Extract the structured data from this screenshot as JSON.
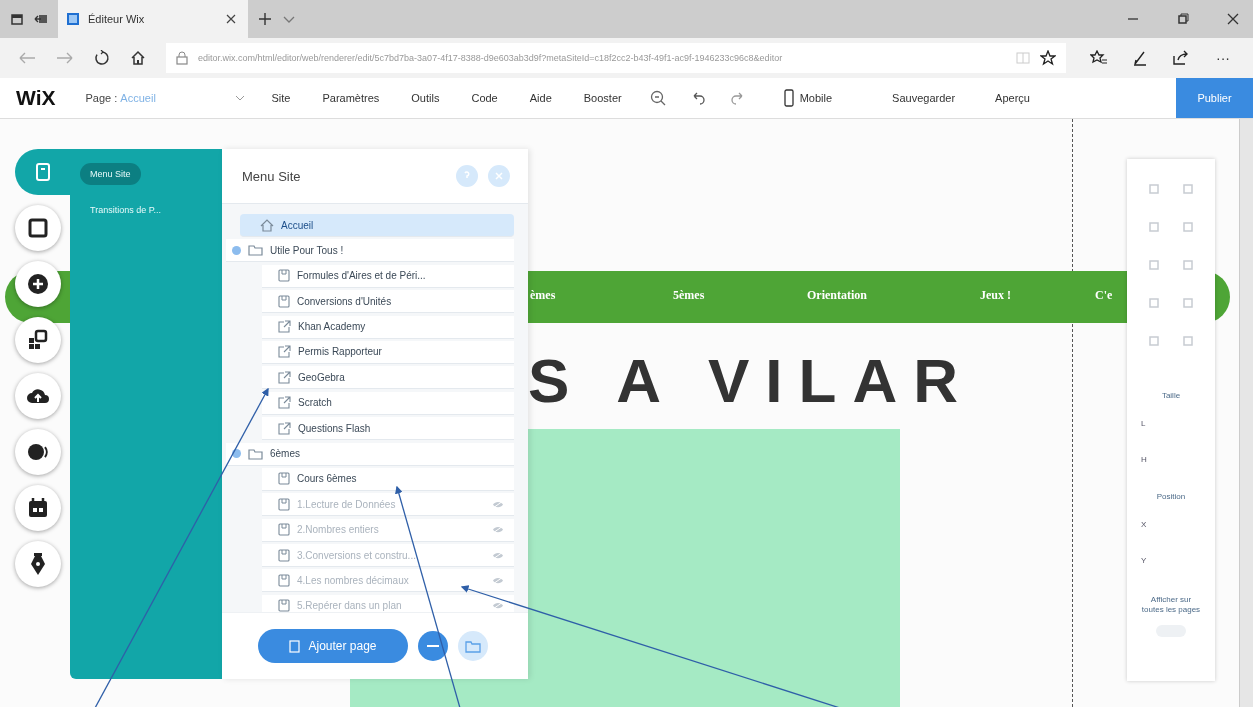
{
  "browser": {
    "tab_title": "Éditeur Wix",
    "url": "editor.wix.com/html/editor/web/renderer/edit/5c7bd7ba-3a07-4f17-8388-d9e603ab3d9f?metaSiteId=c18f2cc2-b43f-49f1-ac9f-1946233c96c8&editor",
    "more": "···"
  },
  "editor_bar": {
    "logo": "WiX",
    "page_label": "Page :",
    "page_name": "Accueil",
    "menus": [
      "Site",
      "Paramètres",
      "Outils",
      "Code",
      "Aide",
      "Booster"
    ],
    "mobile": "Mobile",
    "save": "Sauvegarder",
    "preview": "Aperçu",
    "publish": "Publier"
  },
  "site": {
    "nav": [
      "èmes",
      "5èmes",
      "Orientation",
      "Jeux !",
      "C'e"
    ],
    "title": "S A VILAR"
  },
  "side_panel": {
    "tabs": [
      {
        "label": "Menu Site",
        "selected": true
      },
      {
        "label": "Transitions de P...",
        "selected": false
      }
    ]
  },
  "menu_panel": {
    "title": "Menu Site",
    "add_button": "Ajouter page",
    "pages": [
      {
        "kind": "home",
        "label": "Accueil",
        "selected": true,
        "hidden": false
      },
      {
        "kind": "folder",
        "label": "Utile Pour Tous !",
        "selected": false,
        "hidden": false,
        "children": [
          {
            "kind": "page",
            "label": "Formules d'Aires et de Péri...",
            "selected": false,
            "hidden": false
          },
          {
            "kind": "page",
            "label": "Conversions d'Unités",
            "selected": false,
            "hidden": false
          },
          {
            "kind": "link",
            "label": "Khan Academy",
            "selected": false,
            "hidden": false
          },
          {
            "kind": "link",
            "label": "Permis Rapporteur",
            "selected": false,
            "hidden": false
          },
          {
            "kind": "link",
            "label": "GeoGebra",
            "selected": false,
            "hidden": false
          },
          {
            "kind": "link",
            "label": "Scratch",
            "selected": false,
            "hidden": false
          },
          {
            "kind": "link",
            "label": "Questions Flash",
            "selected": false,
            "hidden": false
          }
        ]
      },
      {
        "kind": "folder",
        "label": "6èmes",
        "selected": false,
        "hidden": false,
        "children": [
          {
            "kind": "page",
            "label": "Cours 6èmes",
            "selected": false,
            "hidden": false
          },
          {
            "kind": "page",
            "label": "1.Lecture de Données",
            "selected": false,
            "hidden": true
          },
          {
            "kind": "page",
            "label": "2.Nombres entiers",
            "selected": false,
            "hidden": true
          },
          {
            "kind": "page",
            "label": "3.Conversions et constru...",
            "selected": false,
            "hidden": true
          },
          {
            "kind": "page",
            "label": "4.Les nombres décimaux",
            "selected": false,
            "hidden": true
          },
          {
            "kind": "page",
            "label": "5.Repérer dans un plan",
            "selected": false,
            "hidden": true
          }
        ]
      }
    ]
  },
  "inspector": {
    "size_label": "Taille",
    "size_fields": [
      "L",
      "H"
    ],
    "position_label": "Position",
    "position_fields": [
      "X",
      "Y"
    ],
    "show_all": "Afficher sur toutes les pages",
    "show_all_on": false
  }
}
